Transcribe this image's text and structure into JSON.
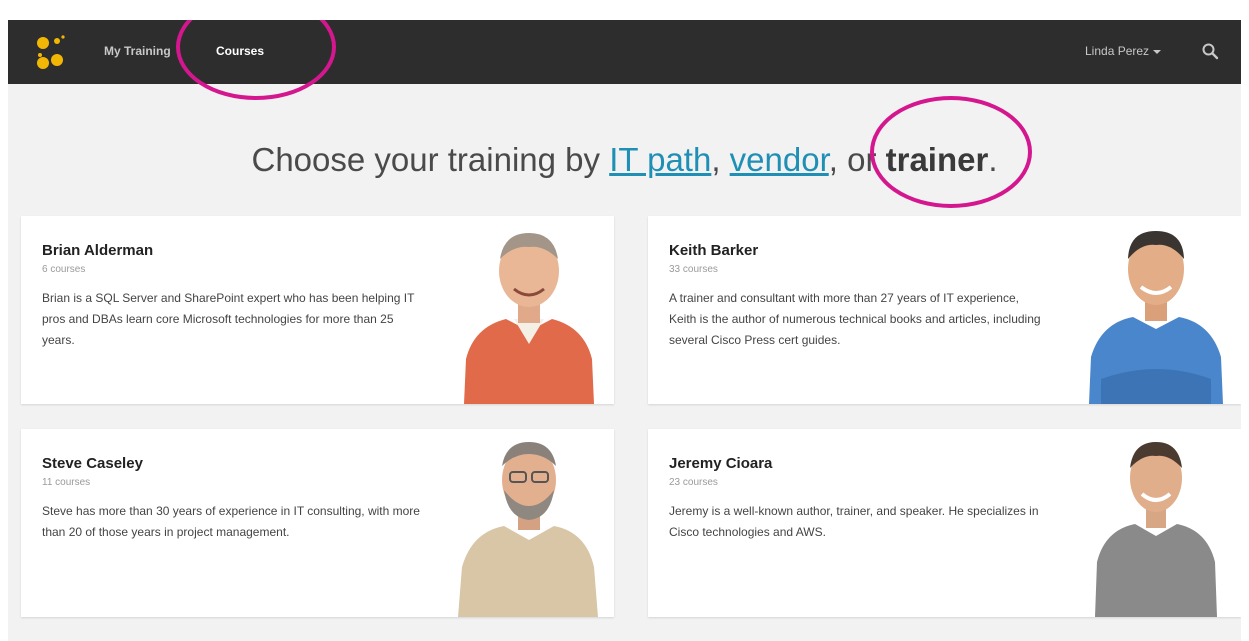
{
  "nav": {
    "items": [
      {
        "label": "My Training"
      },
      {
        "label": "Courses"
      }
    ],
    "user_label": "Linda Perez"
  },
  "headline": {
    "prefix": "Choose your training by ",
    "link_it_path": "IT path",
    "sep1": ", ",
    "link_vendor": "vendor",
    "sep2": ", or ",
    "bold_trainer": "trainer",
    "suffix": "."
  },
  "trainers": [
    {
      "name": "Brian Alderman",
      "courses": "6 courses",
      "bio": "Brian is a SQL Server and SharePoint expert who has been helping IT pros and DBAs learn core Microsoft technologies for more than 25 years.",
      "shirt": "#e06a4a"
    },
    {
      "name": "Keith Barker",
      "courses": "33 courses",
      "bio": "A trainer and consultant with more than 27 years of IT experience, Keith is the author of numerous technical books and articles, including several Cisco Press cert guides.",
      "shirt": "#4a86cc"
    },
    {
      "name": "Steve Caseley",
      "courses": "11 courses",
      "bio": "Steve has more than 30 years of experience in IT consulting, with more than 20 of those years in project management.",
      "shirt": "#d9c6a6"
    },
    {
      "name": "Jeremy Cioara",
      "courses": "23 courses",
      "bio": "Jeremy is a well-known author, trainer, and speaker. He specializes in Cisco technologies and AWS.",
      "shirt": "#8a8a8a"
    }
  ],
  "colors": {
    "accent_link": "#1f8fb5",
    "logo_yellow": "#f2b705",
    "annotation_ring": "#d4178f",
    "navbar": "#2d2d2d"
  },
  "icons": {
    "logo": "yellow-dots-logo-icon",
    "search": "search-icon",
    "caret": "caret-down-icon"
  }
}
